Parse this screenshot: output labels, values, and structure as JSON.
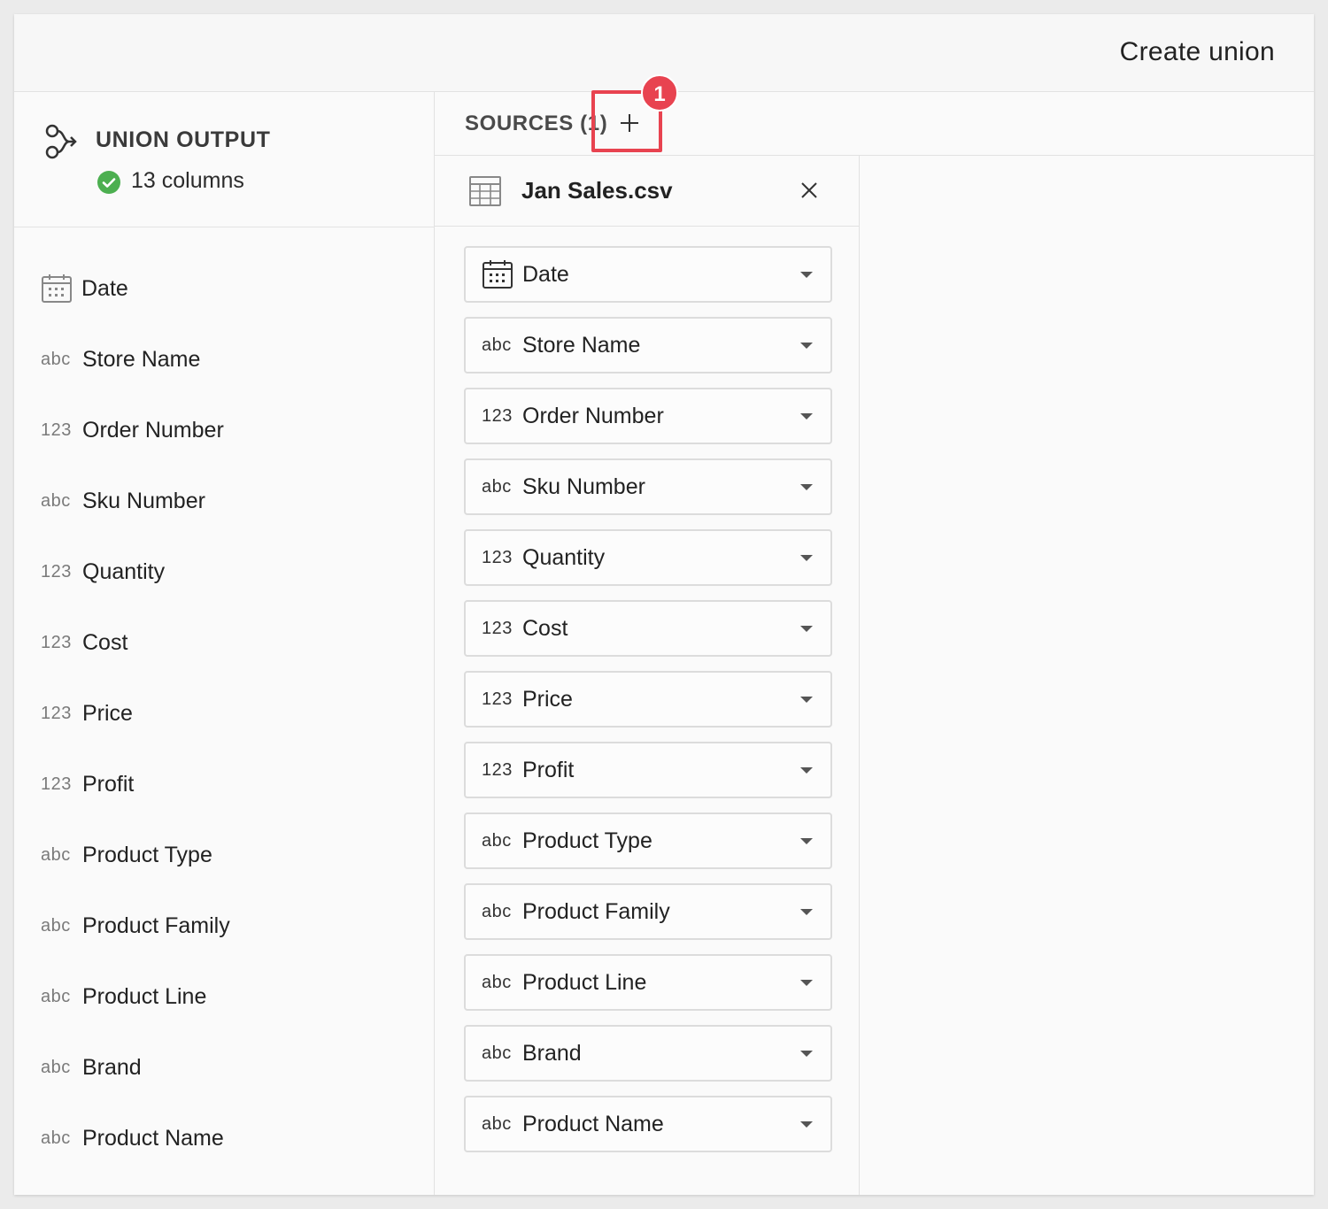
{
  "header": {
    "title": "Create union"
  },
  "union_output": {
    "title": "UNION OUTPUT",
    "status_icon": "check-circle-icon",
    "column_count_label": "13 columns",
    "status_color": "#4caf50"
  },
  "columns": [
    {
      "type": "date",
      "type_label": "",
      "name": "Date"
    },
    {
      "type": "text",
      "type_label": "abc",
      "name": "Store Name"
    },
    {
      "type": "number",
      "type_label": "123",
      "name": "Order Number"
    },
    {
      "type": "text",
      "type_label": "abc",
      "name": "Sku Number"
    },
    {
      "type": "number",
      "type_label": "123",
      "name": "Quantity"
    },
    {
      "type": "number",
      "type_label": "123",
      "name": "Cost"
    },
    {
      "type": "number",
      "type_label": "123",
      "name": "Price"
    },
    {
      "type": "number",
      "type_label": "123",
      "name": "Profit"
    },
    {
      "type": "text",
      "type_label": "abc",
      "name": "Product Type"
    },
    {
      "type": "text",
      "type_label": "abc",
      "name": "Product Family"
    },
    {
      "type": "text",
      "type_label": "abc",
      "name": "Product Line"
    },
    {
      "type": "text",
      "type_label": "abc",
      "name": "Brand"
    },
    {
      "type": "text",
      "type_label": "abc",
      "name": "Product Name"
    }
  ],
  "sources": {
    "label": "SOURCES (1)",
    "add_icon": "plus-icon",
    "annotation_badge": "1",
    "annotation_color": "#e84350",
    "items": [
      {
        "icon": "table-icon",
        "name": "Jan Sales.csv",
        "close_icon": "close-icon",
        "mappings": [
          {
            "type": "date",
            "type_label": "",
            "name": "Date"
          },
          {
            "type": "text",
            "type_label": "abc",
            "name": "Store Name"
          },
          {
            "type": "number",
            "type_label": "123",
            "name": "Order Number"
          },
          {
            "type": "text",
            "type_label": "abc",
            "name": "Sku Number"
          },
          {
            "type": "number",
            "type_label": "123",
            "name": "Quantity"
          },
          {
            "type": "number",
            "type_label": "123",
            "name": "Cost"
          },
          {
            "type": "number",
            "type_label": "123",
            "name": "Price"
          },
          {
            "type": "number",
            "type_label": "123",
            "name": "Profit"
          },
          {
            "type": "text",
            "type_label": "abc",
            "name": "Product Type"
          },
          {
            "type": "text",
            "type_label": "abc",
            "name": "Product Family"
          },
          {
            "type": "text",
            "type_label": "abc",
            "name": "Product Line"
          },
          {
            "type": "text",
            "type_label": "abc",
            "name": "Brand"
          },
          {
            "type": "text",
            "type_label": "abc",
            "name": "Product Name"
          }
        ]
      }
    ]
  }
}
